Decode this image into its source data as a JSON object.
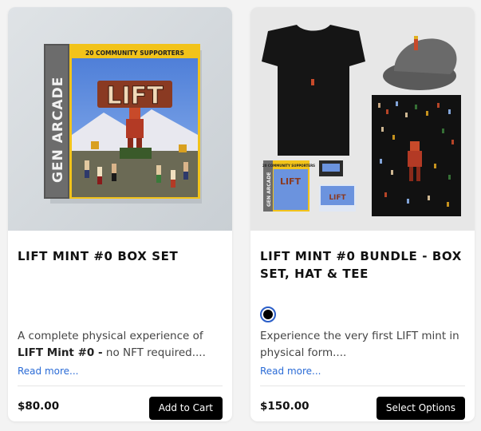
{
  "products": [
    {
      "title": "LIFT MINT #0 BOX SET",
      "image": {
        "banner": "20 COMMUNITY SUPPORTERS",
        "spine": "GEN ARCADE",
        "logo": "LIFT"
      },
      "description_pre": "A complete physical experience of ",
      "description_bold": "LIFT Mint #0 -",
      "description_post": " no NFT required....",
      "read_more": "Read more...",
      "price": "$80.00",
      "button": "Add to Cart"
    },
    {
      "title": "LIFT MINT #0 BUNDLE - BOX SET, HAT & TEE",
      "image": {
        "banner": "20 COMMUNITY SUPPORTERS",
        "spine": "GEN ARCADE",
        "logo": "LIFT"
      },
      "description": "Experience the very first LIFT mint in physical form....",
      "read_more": "Read more...",
      "price": "$150.00",
      "button": "Select Options",
      "swatch_color": "#000000"
    }
  ],
  "colors": {
    "accent_link": "#2a6bd6",
    "button_bg": "#000000",
    "box_banner": "#f2c31a"
  }
}
